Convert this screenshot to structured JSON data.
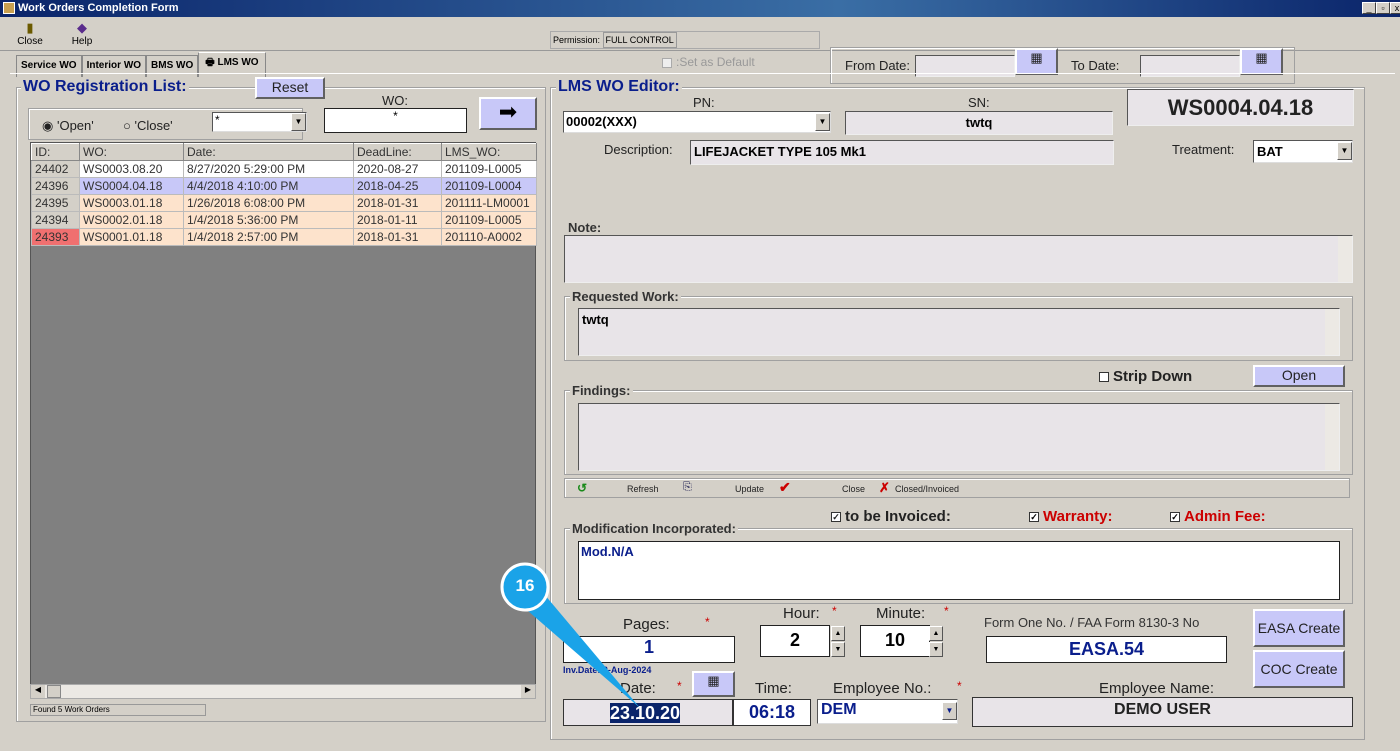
{
  "window": {
    "title": "Work Orders Completion Form",
    "min": "_",
    "max": "▫",
    "close": "x"
  },
  "toolbar": {
    "close_label": "Close",
    "help_label": "Help"
  },
  "permission": {
    "label": "Permission:",
    "value": "FULL CONTROL"
  },
  "set_default": ":Set as Default",
  "tabs": [
    {
      "label": "Service WO"
    },
    {
      "label": "Interior WO"
    },
    {
      "label": "BMS WO"
    },
    {
      "label": "LMS WO",
      "active": true
    }
  ],
  "dates": {
    "from_label": "From Date:",
    "to_label": "To Date:",
    "from_value": "",
    "to_value": ""
  },
  "list": {
    "title": "WO Registration List:",
    "reset": "Reset",
    "wo_label": "WO:",
    "wo_value": "*",
    "open_label": "'Open'",
    "close_label": "'Close'",
    "filter_value": "*",
    "go_icon": "➡",
    "columns": [
      "ID:",
      "WO:",
      "Date:",
      "DeadLine:",
      "LMS_WO:"
    ],
    "rows": [
      {
        "id": "24402",
        "wo": "WS0003.08.20",
        "date": "8/27/2020 5:29:00 PM",
        "deadline": "2020-08-27",
        "lms": "201109-L0005",
        "style": "white"
      },
      {
        "id": "24396",
        "wo": "WS0004.04.18",
        "date": "4/4/2018 4:10:00 PM",
        "deadline": "2018-04-25",
        "lms": "201109-L0004",
        "style": "selected"
      },
      {
        "id": "24395",
        "wo": "WS0003.01.18",
        "date": "1/26/2018 6:08:00 PM",
        "deadline": "2018-01-31",
        "lms": "201111-LM0001",
        "style": "peach"
      },
      {
        "id": "24394",
        "wo": "WS0002.01.18",
        "date": "1/4/2018 5:36:00 PM",
        "deadline": "2018-01-11",
        "lms": "201109-L0005",
        "style": "peach"
      },
      {
        "id": "24393",
        "wo": "WS0001.01.18",
        "date": "1/4/2018 2:57:00 PM",
        "deadline": "2018-01-31",
        "lms": "201110-A0002",
        "style": "peach-red"
      }
    ],
    "status": "Found 5 Work Orders"
  },
  "editor": {
    "title": "LMS WO Editor:",
    "pn_label": "PN:",
    "pn_value": "00002(XXX)",
    "sn_label": "SN:",
    "sn_value": "twtq",
    "wo_number": "WS0004.04.18",
    "description_label": "Description:",
    "description_value": "LIFEJACKET TYPE 105 Mk1",
    "treatment_label": "Treatment:",
    "treatment_value": "BAT",
    "note_label": "Note:",
    "note_value": "",
    "requested_label": "Requested Work:",
    "requested_value": "twtq",
    "strip_down_label": "Strip Down",
    "open_button": "Open",
    "findings_label": "Findings:",
    "findings_value": "",
    "actions": {
      "refresh": "Refresh",
      "update": "Update",
      "close": "Close",
      "closed_invoiced": "Closed/Invoiced"
    },
    "to_be_invoiced": "to be Invoiced:",
    "warranty": "Warranty:",
    "admin_fee": "Admin Fee:",
    "mod_label": "Modification Incorporated:",
    "mod_value": "Mod.N/A",
    "pages_label": "Pages:",
    "pages_value": "1",
    "hour_label": "Hour:",
    "hour_value": "2",
    "minute_label": "Minute:",
    "minute_value": "10",
    "form_one_label": "Form One No. / FAA Form 8130-3 No",
    "form_one_value": "EASA.54",
    "easa_create": "EASA Create",
    "coc_create": "COC Create",
    "inv_date": "Inv.Date: 2-Aug-2024",
    "date_label": "Date:",
    "date_value": "23.10.20",
    "time_label": "Time:",
    "time_value": "06:18",
    "employee_no_label": "Employee No.:",
    "employee_no_value": "DEM",
    "employee_name_label": "Employee Name:",
    "employee_name_value": "DEMO USER",
    "required": "*"
  },
  "annotation": {
    "step": "16",
    "color": "#1aa3e8"
  }
}
